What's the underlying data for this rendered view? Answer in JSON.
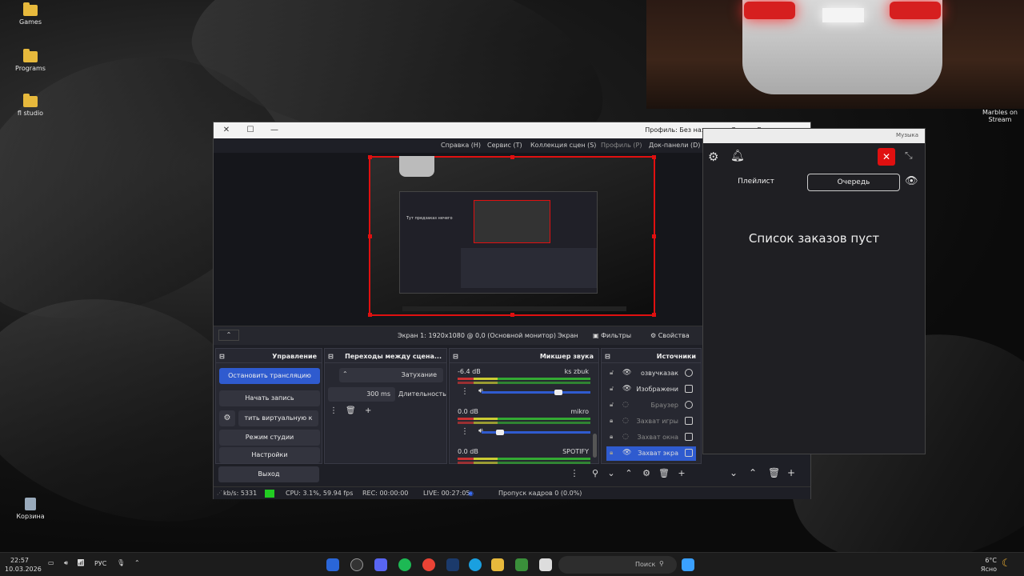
{
  "desktop": {
    "icons": [
      "Games",
      "Programs",
      "fl studio",
      "Корзина"
    ],
    "right_icon": "Marbles on Stream"
  },
  "obs": {
    "window_title": "Профиль: Без названия - Сцены: Без названия",
    "menu": [
      "Док-панели (D)",
      "Профиль (P)",
      "Коллекция сцен (S)",
      "Сервис (T)",
      "Справка (H)"
    ],
    "prop": {
      "properties": "Свойства",
      "filters": "Фильтры",
      "screen_label": "Экран",
      "screen_value": "Экран 1: 1920x1080 @ 0,0 (Основной монитор)"
    },
    "sources": {
      "title": "Источники",
      "items": [
        "озвучказак",
        "Изображени",
        "Браузер",
        "Захват игры",
        "Захват окна",
        "Захват экра"
      ]
    },
    "mixer": {
      "title": "Микшер звука",
      "channels": [
        {
          "name": "ks zbuk",
          "db": "-6.4 dB",
          "level": 0.28
        },
        {
          "name": "mikro",
          "db": "0.0 dB",
          "level": 0.86
        },
        {
          "name": "SPOTIFY",
          "db": "0.0 dB",
          "level": 1
        }
      ]
    },
    "transitions": {
      "title": "Переходы между сцена...",
      "type": "Затухание",
      "duration_label": "Длительность",
      "duration": "300 ms"
    },
    "controls": {
      "title": "Управление",
      "stop_stream": "Остановить трансляцию",
      "start_record": "Начать запись",
      "virtual_cam": "тить виртуальную к",
      "studio": "Режим студии",
      "settings": "Настройки",
      "exit": "Выход"
    },
    "status": {
      "dropped": "Пропуск кадров 0 (0.0%)",
      "live": "LIVE: 00:27:05",
      "rec": "REC: 00:00:00",
      "cpu": "CPU: 3.1%, 59.94 fps",
      "kbps": "kb/s: 5331"
    },
    "inner_text": "Тут предзаказ нечего"
  },
  "twitch": {
    "window_label": "Музыка",
    "tab_queue": "Очередь",
    "tab_playlist": "Плейлист",
    "empty": "Список заказов пуст"
  },
  "taskbar": {
    "search": "Поиск",
    "lang": "РУС",
    "time": "22:57",
    "date": "10.03.2026",
    "weather_temp": "6°C",
    "weather_text": "Ясно"
  },
  "colors": {
    "accent": "#2f5bcf",
    "record": "#e01010",
    "kbps_ok": "#22cc22"
  }
}
